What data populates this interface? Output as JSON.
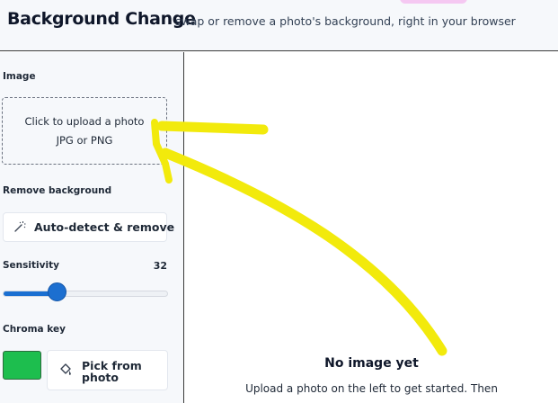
{
  "header": {
    "title": "Background Change",
    "subtitle": "swap or remove a photo's background, right in your browser"
  },
  "sidebar": {
    "image_label": "Image",
    "upload": {
      "line1": "Click to upload a photo",
      "line2": "JPG or PNG"
    },
    "remove_label": "Remove background",
    "autodetect_button": "Auto-detect & remove",
    "sensitivity_label": "Sensitivity",
    "sensitivity_value": "32",
    "sensitivity_fraction": 0.32,
    "chroma_label": "Chroma key",
    "chroma_color": "#1DBE4E",
    "pick_button": "Pick from photo"
  },
  "main": {
    "empty_title": "No image yet",
    "empty_desc": "Upload a photo on the left to get started. Then"
  },
  "colors": {
    "accent": "#1C6FD0",
    "annotation": "#F2EA0C"
  },
  "icons": {
    "autodetect": "magic-wand-icon",
    "pick": "eyedropper-icon"
  }
}
